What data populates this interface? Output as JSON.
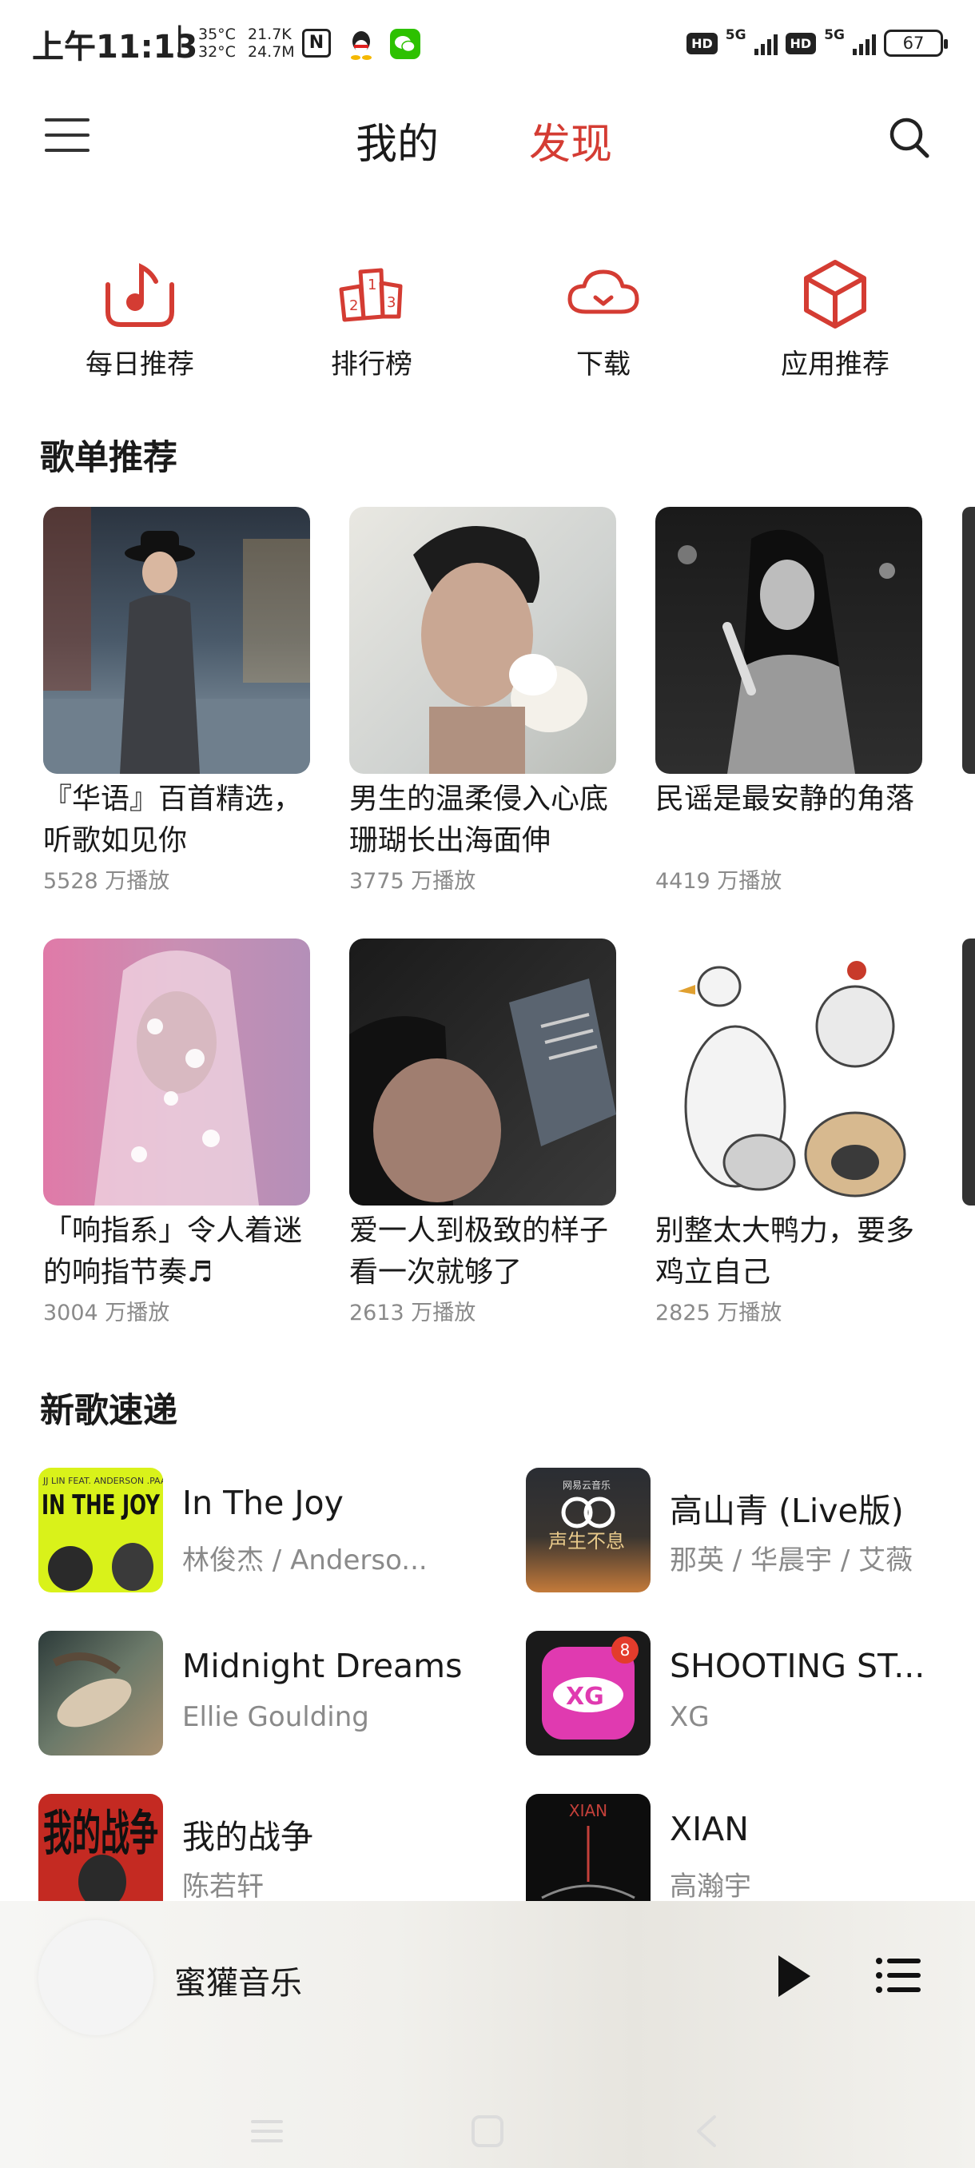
{
  "status_bar": {
    "time": "上午11:13",
    "separator": "|",
    "temp_top": "35°C",
    "temp_bottom": "32°C",
    "speed_top": "21.7K",
    "speed_bottom": "24.7M",
    "nfc": "N",
    "hd1": "HD",
    "net1": "5G",
    "hd2": "HD",
    "net2": "5G",
    "battery": "67"
  },
  "header": {
    "tabs": [
      {
        "label": "我的",
        "active": false
      },
      {
        "label": "发现",
        "active": true
      }
    ],
    "accent_color": "#d43c33"
  },
  "quick_entries": [
    {
      "label": "每日推荐",
      "icon": "daily-music-icon"
    },
    {
      "label": "排行榜",
      "icon": "podium-icon"
    },
    {
      "label": "下载",
      "icon": "cloud-download-icon"
    },
    {
      "label": "应用推荐",
      "icon": "cube-icon"
    }
  ],
  "playlists_section": {
    "title": "歌单推荐",
    "items": [
      {
        "title": "『华语』百首精选，听歌如见你",
        "plays": "5528 万播放"
      },
      {
        "title": "男生的温柔侵入心底 珊瑚长出海面伸",
        "plays": "3775 万播放"
      },
      {
        "title": "民谣是最安静的角落",
        "plays": "4419 万播放"
      },
      {
        "title": "「响指系」令人着迷的响指节奏♬",
        "plays": "3004 万播放"
      },
      {
        "title": "爱一人到极致的样子看一次就够了",
        "plays": "2613 万播放"
      },
      {
        "title": "别整太大鸭力，要多鸡立自己",
        "plays": "2825 万播放"
      }
    ]
  },
  "songs_section": {
    "title": "新歌速递",
    "items": [
      {
        "name": "In The Joy",
        "artist": "林俊杰 / Anderso...",
        "cover_text": "IN THE JOY",
        "cover_caption": "JJ LIN  FEAT. ANDERSON .PAAK"
      },
      {
        "name": "高山青 (Live版)",
        "artist": "那英 / 华晨宇 / 艾薇",
        "cover_text": "声生不息",
        "cover_caption": "网易云音乐"
      },
      {
        "name": "Midnight Dreams",
        "artist": "Ellie Goulding"
      },
      {
        "name": "SHOOTING ST...",
        "artist": "XG",
        "badge": "8"
      },
      {
        "name": "我的战争",
        "artist": "陈若轩",
        "cover_text": "我的战争"
      },
      {
        "name": "XIAN",
        "artist": "高瀚宇",
        "cover_text": "XIAN"
      }
    ]
  },
  "player": {
    "title": "蜜獾音乐"
  }
}
